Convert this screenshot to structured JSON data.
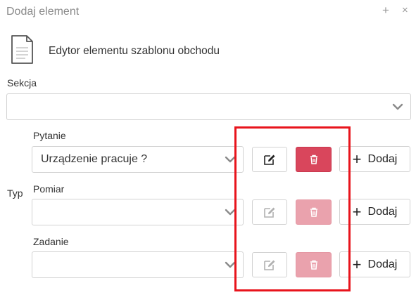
{
  "dialog": {
    "title": "Dodaj element",
    "add_symbol": "+",
    "close_symbol": "×",
    "subtitle": "Edytor elementu szablonu obchodu",
    "doc_icon": "document-icon"
  },
  "sekcja": {
    "label": "Sekcja",
    "value": ""
  },
  "typ": {
    "label": "Typ"
  },
  "rows": [
    {
      "label": "Pytanie",
      "value": "Urządzenie pracuje ?",
      "add_label": "Dodaj",
      "actions_enabled": true
    },
    {
      "label": "Pomiar",
      "value": "",
      "add_label": "Dodaj",
      "actions_enabled": false
    },
    {
      "label": "Zadanie",
      "value": "",
      "add_label": "Dodaj",
      "actions_enabled": false
    }
  ],
  "icons": {
    "edit": "edit-icon",
    "delete": "trash-icon",
    "plus": "plus-icon",
    "chevron": "chevron-down-icon"
  },
  "colors": {
    "delete_active": "#d9465c",
    "delete_disabled": "#eaa2ad",
    "highlight": "#e8141c"
  }
}
